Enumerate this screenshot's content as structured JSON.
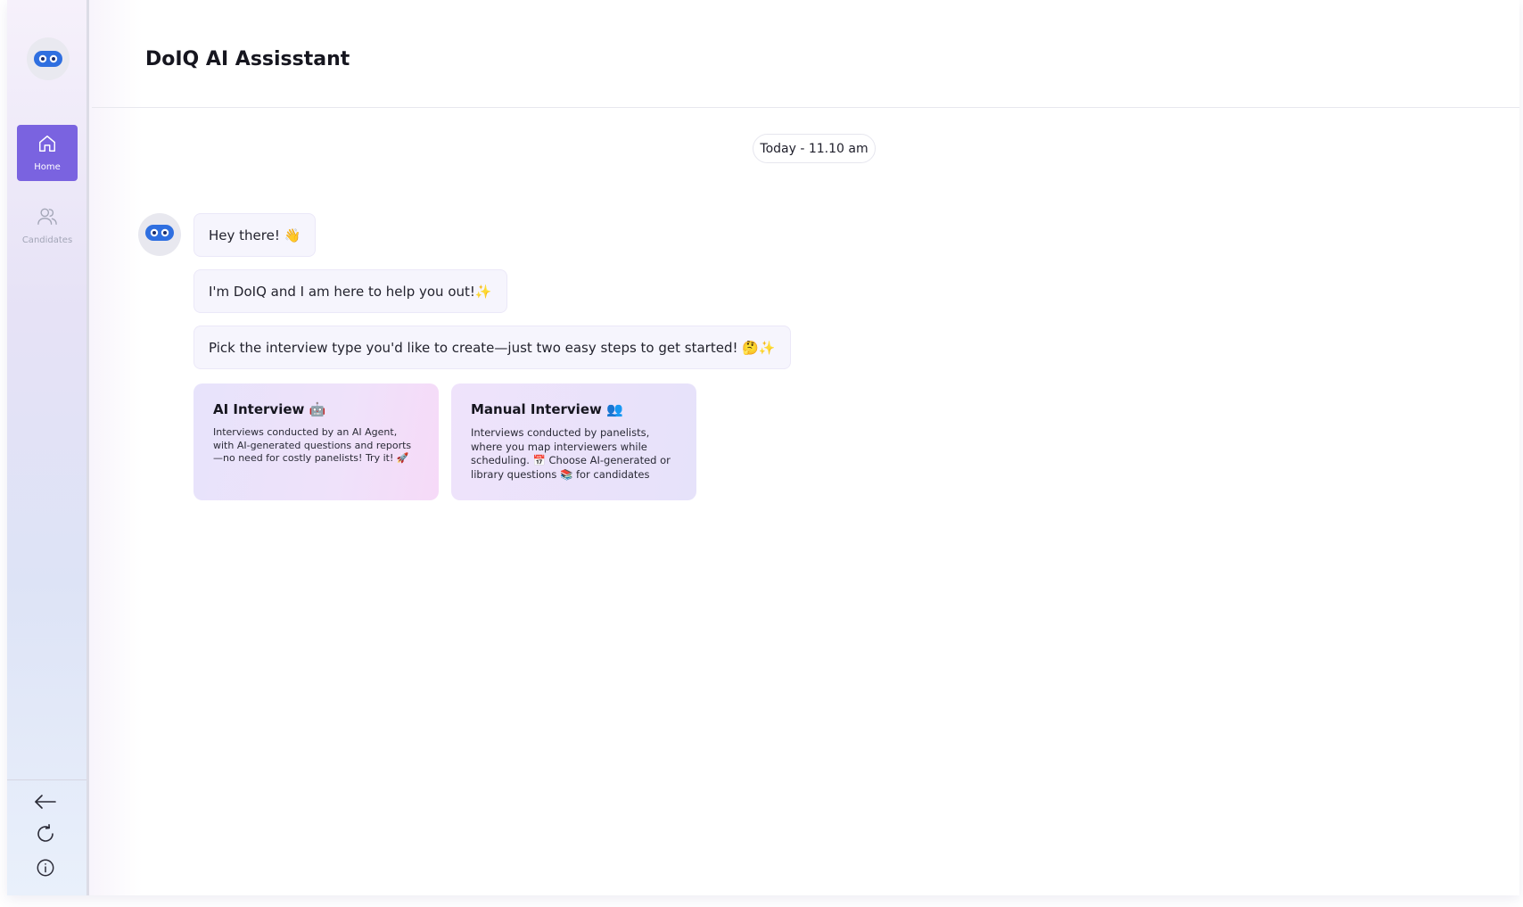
{
  "header": {
    "title": "DoIQ AI Assisstant"
  },
  "sidebar": {
    "nav": [
      {
        "label": "Home",
        "icon": "home-icon",
        "active": true
      },
      {
        "label": "Candidates",
        "icon": "users-icon",
        "active": false
      }
    ],
    "bottom_icons": [
      "back-arrow-icon",
      "refresh-icon",
      "info-icon"
    ]
  },
  "chat": {
    "date": "Today - 11.10 am",
    "messages": [
      "Hey there! 👋",
      "I'm DoIQ and I am here to help you out!✨",
      "Pick the interview type you'd like to create—just two easy steps to get started! 🤔✨"
    ],
    "options": [
      {
        "title": "AI Interview 🤖",
        "description": "Interviews conducted by an AI Agent, with AI-generated questions and reports—no need for costly panelists! Try it! 🚀"
      },
      {
        "title": "Manual Interview 👥",
        "description": "Interviews conducted by panelists, where you map interviewers while scheduling. 📅 Choose AI-generated or library questions 📚 for candidates"
      }
    ]
  },
  "colors": {
    "accent": "#7a63e0",
    "bot_eyes": "#2f6fe0",
    "inactive_nav": "#a3a6b7"
  }
}
